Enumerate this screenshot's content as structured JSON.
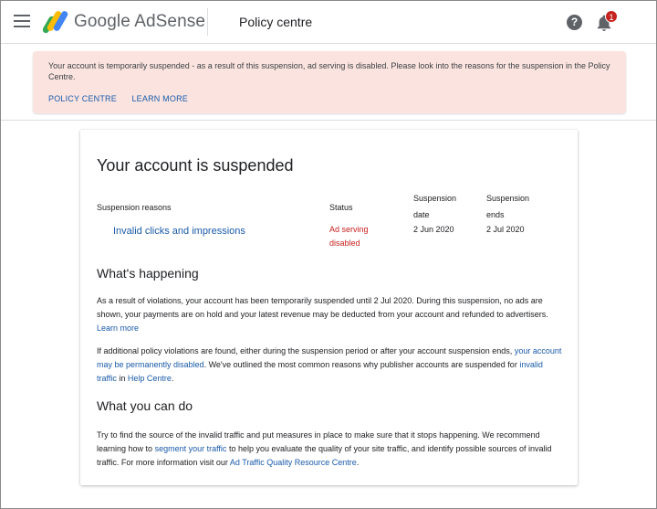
{
  "header": {
    "brand_google": "Google",
    "brand_product": "AdSense",
    "page_title": "Policy centre",
    "help_icon_glyph": "?",
    "notification_count": "1"
  },
  "banner": {
    "message": "Your account is temporarily suspended - as a result of this suspension, ad serving is disabled. Please look into the reasons for the suspension in the Policy Centre.",
    "link_policy": "POLICY CENTRE",
    "link_learn": "LEARN MORE",
    "background": "#fbe4e0"
  },
  "card": {
    "title": "Your account is suspended",
    "table": {
      "headers": [
        "Suspension reasons",
        "Status",
        "Suspension date",
        "Suspension ends"
      ],
      "header_date_lines": [
        "Suspension",
        "date"
      ],
      "header_ends_lines": [
        "Suspension",
        "ends"
      ],
      "row": {
        "reason": "Invalid clicks and impressions",
        "status_lines": [
          "Ad serving",
          "disabled"
        ],
        "date": "2 Jun 2020",
        "ends": "2 Jul 2020"
      }
    },
    "happening": {
      "title": "What's happening",
      "p1_text": "As a result of violations, your account has been temporarily suspended until 2 Jul 2020. During this suspension, no ads are shown, your payments are on hold and your latest revenue may be deducted from your account and refunded to advertisers.",
      "p1_link": "Learn more",
      "p2_a": "If additional policy violations are found, either during the suspension period or after your account suspension ends,",
      "p2_link1": "your account may be permanently disabled",
      "p2_b": ". We've outlined the most common reasons why publisher accounts are suspended for",
      "p2_link2": "invalid traffic",
      "p2_c": "in",
      "p2_link3": "Help Centre",
      "p2_d": "."
    },
    "can_do": {
      "title": "What you can do",
      "p_a": "Try to find the source of the invalid traffic and put measures in place to make sure that it stops happening. We recommend learning how to",
      "p_link1": "segment your traffic",
      "p_b": "to help you evaluate the quality of your site traffic, and identify possible sources of invalid traffic. For more information visit our",
      "p_link2": "Ad Traffic Quality Resource Centre",
      "p_c": "."
    }
  },
  "colors": {
    "link": "#1a5aa8",
    "status_red": "#c5221f",
    "logo_blue": "#4285f4",
    "logo_yellow": "#fbbc04",
    "logo_green": "#34a853"
  }
}
